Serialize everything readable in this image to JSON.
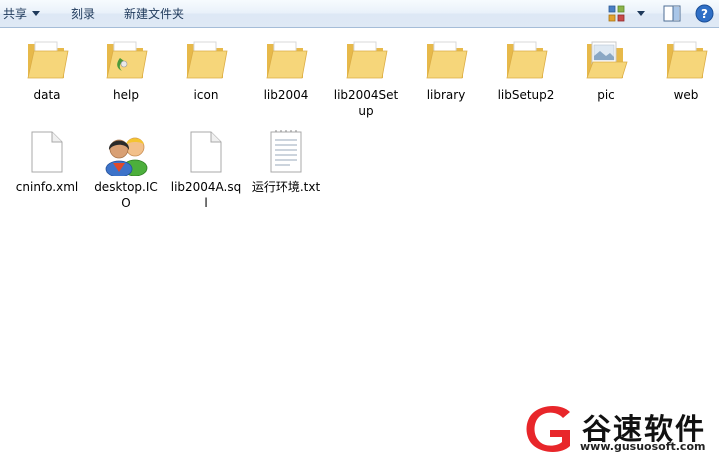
{
  "toolbar": {
    "share_label": "共享",
    "burn_label": "刻录",
    "new_folder_label": "新建文件夹"
  },
  "items": [
    {
      "label": "data",
      "kind": "folder"
    },
    {
      "label": "help",
      "kind": "folder-help"
    },
    {
      "label": "icon",
      "kind": "folder"
    },
    {
      "label": "lib2004",
      "kind": "folder"
    },
    {
      "label": "lib2004Setup",
      "kind": "folder"
    },
    {
      "label": "library",
      "kind": "folder"
    },
    {
      "label": "libSetup2",
      "kind": "folder"
    },
    {
      "label": "pic",
      "kind": "folder-pic"
    },
    {
      "label": "web",
      "kind": "folder"
    },
    {
      "label": "cninfo.xml",
      "kind": "file-blank"
    },
    {
      "label": "desktop.ICO",
      "kind": "file-users-icon"
    },
    {
      "label": "lib2004A.sql",
      "kind": "file-blank"
    },
    {
      "label": "运行环境.txt",
      "kind": "file-text"
    }
  ],
  "watermark": {
    "brand_text": "谷速软件",
    "url": "www.gusuosoft.com",
    "accent_color": "#e8262a"
  },
  "colors": {
    "folder_front": "#f6d67a",
    "folder_back": "#e7b94a",
    "toolbar_text": "#1e395b"
  }
}
